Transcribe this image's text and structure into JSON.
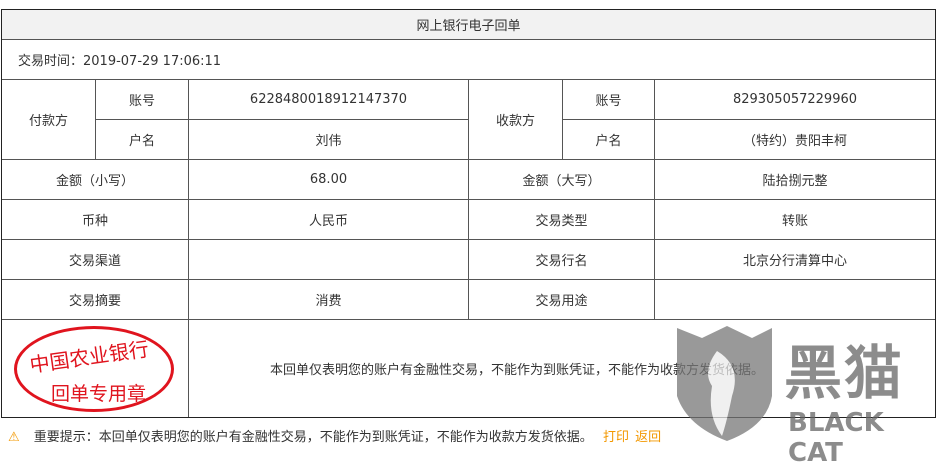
{
  "title": "网上银行电子回单",
  "time_label": "交易时间：2019-07-29 17:06:11",
  "payer": {
    "label": "付款方",
    "acct_label": "账号",
    "acct": "6228480018912147370",
    "name_label": "户名",
    "name": "刘伟"
  },
  "payee": {
    "label": "收款方",
    "acct_label": "账号",
    "acct": "829305057229960",
    "name_label": "户名",
    "name": "（特约）贵阳丰柯"
  },
  "rows": [
    {
      "k1": "金额（小写）",
      "v1": "68.00",
      "k2": "金额（大写）",
      "v2": "陆拾捌元整"
    },
    {
      "k1": "币种",
      "v1": "人民币",
      "k2": "交易类型",
      "v2": "转账"
    },
    {
      "k1": "交易渠道",
      "v1": "",
      "k2": "交易行名",
      "v2": "北京分行清算中心"
    },
    {
      "k1": "交易摘要",
      "v1": "消费",
      "k2": "交易用途",
      "v2": ""
    }
  ],
  "stamp": {
    "line1": "中国农业银行",
    "line2": "回单专用章"
  },
  "disclaimer": "本回单仅表明您的账户有金融性交易，不能作为到账凭证，不能作为收款方发货依据。",
  "notice": "重要提示：本回单仅表明您的账户有金融性交易，不能作为到账凭证，不能作为收款方发货依据。",
  "print_label": "打印",
  "back_label": "返回",
  "watermark": {
    "cn": "黑猫",
    "en": "BLACK CAT"
  }
}
